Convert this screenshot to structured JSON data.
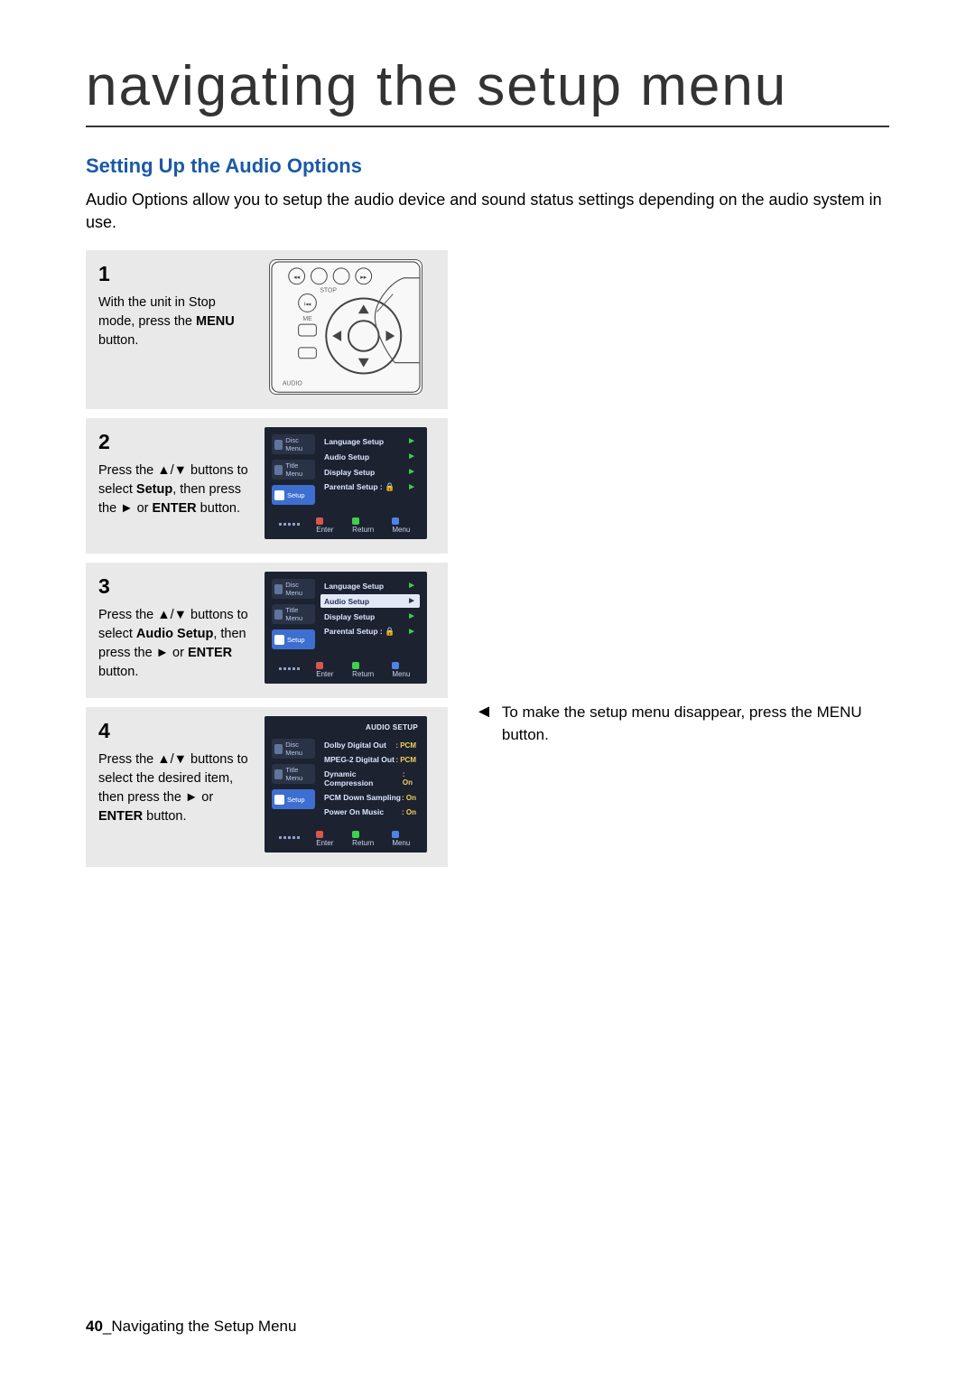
{
  "title": "navigating the setup menu",
  "heading": "Setting Up the Audio Options",
  "intro": "Audio Options allow you to setup the audio device and sound status settings depending on the audio system in use.",
  "steps": [
    {
      "num": "1",
      "text": "With the unit in Stop mode, press the <b>MENU</b> button."
    },
    {
      "num": "2",
      "text": "Press the ▲/▼ buttons to select <b>Setup</b>, then press the ► or <b>ENTER</b> button."
    },
    {
      "num": "3",
      "text": "Press the ▲/▼ buttons to select <b>Audio Setup</b>, then press the ► or <b>ENTER</b> button."
    },
    {
      "num": "4",
      "text": "Press the ▲/▼ buttons to select the desired item, then press the ► or <b>ENTER</b> button."
    }
  ],
  "side_labels": {
    "disc": "Disc Menu",
    "title": "Title Menu",
    "setup": "Setup"
  },
  "osd_menu": {
    "lang": "Language Setup",
    "audio": "Audio Setup",
    "display": "Display Setup",
    "parental": "Parental Setup :"
  },
  "osd_keys": {
    "enter": "Enter",
    "return": "Return",
    "menu": "Menu"
  },
  "audio_setup": {
    "header": "AUDIO SETUP",
    "rows": [
      {
        "label": "Dolby Digital Out",
        "value": ": PCM"
      },
      {
        "label": "MPEG-2 Digital Out",
        "value": ": PCM"
      },
      {
        "label": "Dynamic Compression",
        "value": ": On"
      },
      {
        "label": "PCM Down Sampling",
        "value": ": On"
      },
      {
        "label": "Power On Music",
        "value": ": On"
      }
    ]
  },
  "tip": "To make the setup menu disappear, press the MENU button.",
  "remote_labels": {
    "stop": "STOP",
    "me": "ME",
    "audio": "AUDIO"
  },
  "footer_num": "40",
  "footer_text": "_Navigating the Setup Menu"
}
